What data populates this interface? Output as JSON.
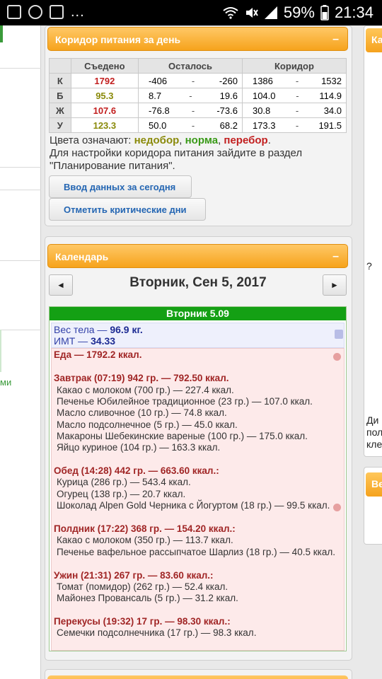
{
  "status_bar": {
    "battery": "59%",
    "time": "21:34"
  },
  "left_col": {
    "text": "ми"
  },
  "right_col": {
    "head1": "Ка",
    "head2": "Ве",
    "lines": [
      "Ди",
      "пол",
      "кле"
    ]
  },
  "nutrition_panel": {
    "title": "Коридор питания за день",
    "collapse": "–",
    "columns": [
      "Съедено",
      "Осталось",
      "Коридор"
    ],
    "rows": [
      {
        "label": "К",
        "eaten": "1792",
        "eaten_color": "#c21f1f",
        "left_min": "-406",
        "left_max": "-260",
        "cor_min": "1386",
        "cor_max": "1532"
      },
      {
        "label": "Б",
        "eaten": "95.3",
        "eaten_color": "#8a8a0a",
        "left_min": "8.7",
        "left_max": "19.6",
        "cor_min": "104.0",
        "cor_max": "114.9"
      },
      {
        "label": "Ж",
        "eaten": "107.6",
        "eaten_color": "#c21f1f",
        "left_min": "-76.8",
        "left_max": "-73.6",
        "cor_min": "30.8",
        "cor_max": "34.0"
      },
      {
        "label": "У",
        "eaten": "123.3",
        "eaten_color": "#8a8a0a",
        "left_min": "50.0",
        "left_max": "68.2",
        "cor_min": "173.3",
        "cor_max": "191.5"
      }
    ],
    "dash": "-",
    "legend_prefix": "Цвета означают: ",
    "legend_under": "недобор",
    "legend_norm": "норма",
    "legend_over": "перебор",
    "legend_line2": "Для настройки коридора питания зайдите в раздел",
    "legend_line3": "\"Планирование питания\".",
    "btn_input": "Ввод данных за сегодня",
    "btn_critical": "Отметить критические дни"
  },
  "calendar": {
    "title": "Календарь",
    "collapse": "–",
    "prev": "◄",
    "next": "►",
    "date": "Вторник, Сен 5, 2017",
    "day_label": "Вторник 5.09",
    "weight_prefix": "Вес тела — ",
    "weight_value": "96.9 кг.",
    "bmi_prefix": "ИМТ — ",
    "bmi_value": "34.33",
    "food_total": "Еда — 1792.2 ккал.",
    "meals": [
      {
        "title": "Завтрак (07:19) 942 гр. — 792.50 ккал.",
        "items": [
          "Какао с молоком (700 гр.) — 227.4 ккал.",
          "Печенье Юбилейное традиционное (23 гр.) — 107.0 ккал.",
          "Масло сливочное (10 гр.) — 74.8 ккал.",
          "Масло подсолнечное (5 гр.) — 45.0 ккал.",
          "Макароны Шебекинские вареные (100 гр.) — 175.0 ккал.",
          "Яйцо куриное (104 гр.) — 163.3 ккал."
        ]
      },
      {
        "title": "Обед (14:28) 442 гр. — 663.60 ккал.:",
        "items": [
          "Курица (286 гр.) — 543.4 ккал.",
          "Огурец (138 гр.) — 20.7 ккал.",
          "Шоколад Alpen Gold Черника с Йогуртом (18 гр.) — 99.5 ккал."
        ]
      },
      {
        "title": "Полдник (17:22) 368 гр. — 154.20 ккал.:",
        "items": [
          "Какао с молоком (350 гр.) — 113.7 ккал.",
          "Печенье вафельное рассыпчатое Шарлиз (18 гр.) — 40.5 ккал."
        ]
      },
      {
        "title": "Ужин (21:31) 267 гр. — 83.60 ккал.:",
        "items": [
          "Томат (помидор) (262 гр.) — 52.4 ккал.",
          "Майонез Провансаль (5 гр.) — 31.2 ккал."
        ]
      },
      {
        "title": "Перекусы (19:32) 17 гр. — 98.30 ккал.:",
        "items": [
          "Семечки подсолнечника (17 гр.) — 98.3 ккал."
        ]
      }
    ]
  },
  "colors": {
    "accent": "#f6a31c",
    "day_bar": "#14a014",
    "over": "#c21f1f",
    "under": "#8a8a0a",
    "norm": "#3a9a18"
  }
}
